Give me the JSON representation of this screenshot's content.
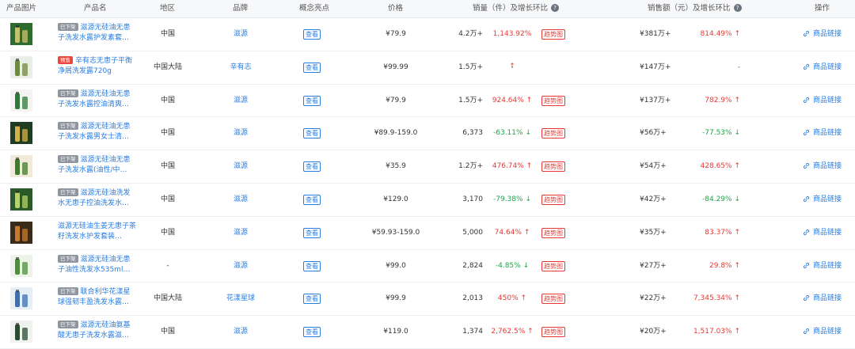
{
  "header": {
    "image": "产品图片",
    "name": "产品名",
    "region": "地区",
    "brand": "品牌",
    "concept": "概念亮点",
    "price": "价格",
    "sales": "销量（件）及增长环比",
    "revenue": "销售额（元）及增长环比",
    "action": "操作",
    "help_glyph": "?"
  },
  "rows": [
    {
      "status": "已下架",
      "status_type": "off",
      "name": "滋源无硅油无患子洗发水露护发素套…",
      "region": "中国",
      "brand": "滋源",
      "concept": "查看",
      "price": "¥79.9",
      "sales": "4.2万+",
      "sales_pct": "1,143.92%",
      "sales_dir": "up",
      "trend": "趋势图",
      "revenue": "¥381万+",
      "rev_pct": "814.49%",
      "rev_dir": "up",
      "link": "商品链接",
      "img_colors": [
        "#2e6b2e",
        "#c9c16a"
      ]
    },
    {
      "status": "预售",
      "status_type": "pre",
      "name": "辛有志无患子平衡净屑洗发露720g",
      "region": "中国大陆",
      "brand": "辛有志",
      "concept": "查看",
      "price": "¥99.99",
      "sales": "1.5万+",
      "sales_pct": "-",
      "sales_dir": "none",
      "trend": "",
      "revenue": "¥147万+",
      "rev_pct": "-",
      "rev_dir": "none",
      "link": "商品链接",
      "img_colors": [
        "#e9efe6",
        "#6d8a3f"
      ]
    },
    {
      "status": "已下架",
      "status_type": "off",
      "name": "滋源无硅油无患子洗发水露控油清爽…",
      "region": "中国",
      "brand": "滋源",
      "concept": "查看",
      "price": "¥79.9",
      "sales": "1.5万+",
      "sales_pct": "924.64%",
      "sales_dir": "up",
      "trend": "趋势图",
      "revenue": "¥137万+",
      "rev_pct": "782.9%",
      "rev_dir": "up",
      "link": "商品链接",
      "img_colors": [
        "#f4f4f2",
        "#2f7a3a"
      ]
    },
    {
      "status": "已下架",
      "status_type": "off",
      "name": "滋源无硅油无患子洗发水露男女士清…",
      "region": "中国",
      "brand": "滋源",
      "concept": "查看",
      "price": "¥89.9-159.0",
      "sales": "6,373",
      "sales_pct": "-63.11%",
      "sales_dir": "down",
      "trend": "趋势图",
      "revenue": "¥56万+",
      "rev_pct": "-77.53%",
      "rev_dir": "down",
      "link": "商品链接",
      "img_colors": [
        "#1f3d22",
        "#d4b24a"
      ]
    },
    {
      "status": "已下架",
      "status_type": "off",
      "name": "滋源无硅油无患子洗发水露(油性/中…",
      "region": "中国",
      "brand": "滋源",
      "concept": "查看",
      "price": "¥35.9",
      "sales": "1.2万+",
      "sales_pct": "476.74%",
      "sales_dir": "up",
      "trend": "趋势图",
      "revenue": "¥54万+",
      "rev_pct": "428.65%",
      "rev_dir": "up",
      "link": "商品链接",
      "img_colors": [
        "#f2ead8",
        "#3d7a2e"
      ]
    },
    {
      "status": "已下架",
      "status_type": "off",
      "name": "滋源无硅油洗发水无患子控油洗发水…",
      "region": "中国",
      "brand": "滋源",
      "concept": "查看",
      "price": "¥129.0",
      "sales": "3,170",
      "sales_pct": "-79.38%",
      "sales_dir": "down",
      "trend": "趋势图",
      "revenue": "¥42万+",
      "rev_pct": "-84.29%",
      "rev_dir": "down",
      "link": "商品链接",
      "img_colors": [
        "#2a5a2a",
        "#b5d36a"
      ]
    },
    {
      "status": "",
      "status_type": "none",
      "name": "滋源无硅油生姜无患子茶籽洗发水护发套装…",
      "region": "中国",
      "brand": "滋源",
      "concept": "查看",
      "price": "¥59.93-159.0",
      "sales": "5,000",
      "sales_pct": "74.64%",
      "sales_dir": "up",
      "trend": "趋势图",
      "revenue": "¥35万+",
      "rev_pct": "83.37%",
      "rev_dir": "up",
      "link": "商品链接",
      "img_colors": [
        "#3a2a1a",
        "#c77b2c"
      ]
    },
    {
      "status": "已下架",
      "status_type": "off",
      "name": "滋源无硅油无患子油性洗发水535ml…",
      "region": "-",
      "brand": "滋源",
      "concept": "查看",
      "price": "¥99.0",
      "sales": "2,824",
      "sales_pct": "-4.85%",
      "sales_dir": "down",
      "trend": "趋势图",
      "revenue": "¥27万+",
      "rev_pct": "29.8%",
      "rev_dir": "up",
      "link": "商品链接",
      "img_colors": [
        "#eef3ea",
        "#4c8f3a"
      ]
    },
    {
      "status": "已下架",
      "status_type": "off",
      "name": "联合利华花漾星球强韧丰盈洗发水露…",
      "region": "中国大陆",
      "brand": "花漾星球",
      "concept": "查看",
      "price": "¥99.9",
      "sales": "2,013",
      "sales_pct": "450%",
      "sales_dir": "up",
      "trend": "趋势图",
      "revenue": "¥22万+",
      "rev_pct": "7,345.34%",
      "rev_dir": "up",
      "link": "商品链接",
      "img_colors": [
        "#e6eef6",
        "#3b6fb0"
      ]
    },
    {
      "status": "已下架",
      "status_type": "off",
      "name": "滋源无硅油氨基酸无患子洗发水露滋…",
      "region": "中国",
      "brand": "滋源",
      "concept": "查看",
      "price": "¥119.0",
      "sales": "1,374",
      "sales_pct": "2,762.5%",
      "sales_dir": "up",
      "trend": "趋势图",
      "revenue": "¥20万+",
      "rev_pct": "1,517.03%",
      "rev_dir": "up",
      "link": "商品链接",
      "img_colors": [
        "#f0f2f0",
        "#2d4d33"
      ]
    }
  ]
}
